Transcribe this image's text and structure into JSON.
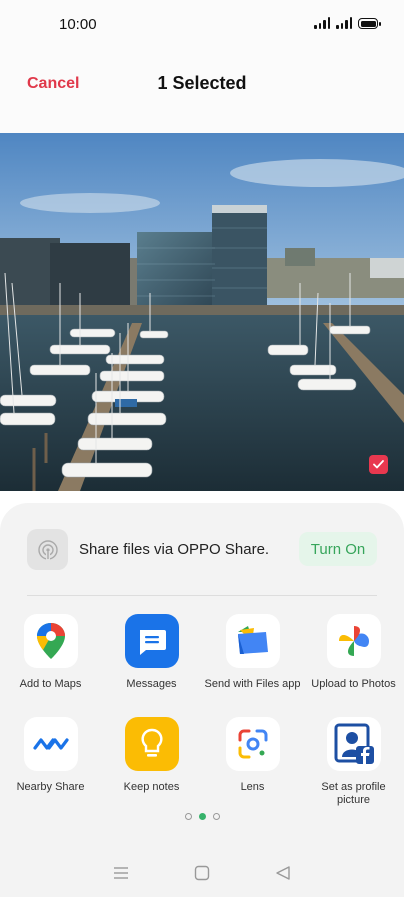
{
  "status_bar": {
    "time": "10:00"
  },
  "header": {
    "cancel_label": "Cancel",
    "title": "1 Selected"
  },
  "share": {
    "text": "Share files via OPPO Share.",
    "button_label": "Turn On"
  },
  "apps": [
    {
      "label": "Add to Maps",
      "icon": "google-maps-icon"
    },
    {
      "label": "Messages",
      "icon": "messages-icon"
    },
    {
      "label": "Send with Files app",
      "icon": "files-app-icon"
    },
    {
      "label": "Upload to Photos",
      "icon": "google-photos-icon"
    },
    {
      "label": "Nearby Share",
      "icon": "nearby-share-icon"
    },
    {
      "label": "Keep notes",
      "icon": "keep-notes-icon"
    },
    {
      "label": "Lens",
      "icon": "lens-icon"
    },
    {
      "label": "Set as profile picture",
      "icon": "facebook-profile-icon"
    }
  ],
  "pagination": {
    "pages": 3,
    "current": 2
  },
  "colors": {
    "accent_red": "#e0384a",
    "accent_green": "#37a55b"
  }
}
